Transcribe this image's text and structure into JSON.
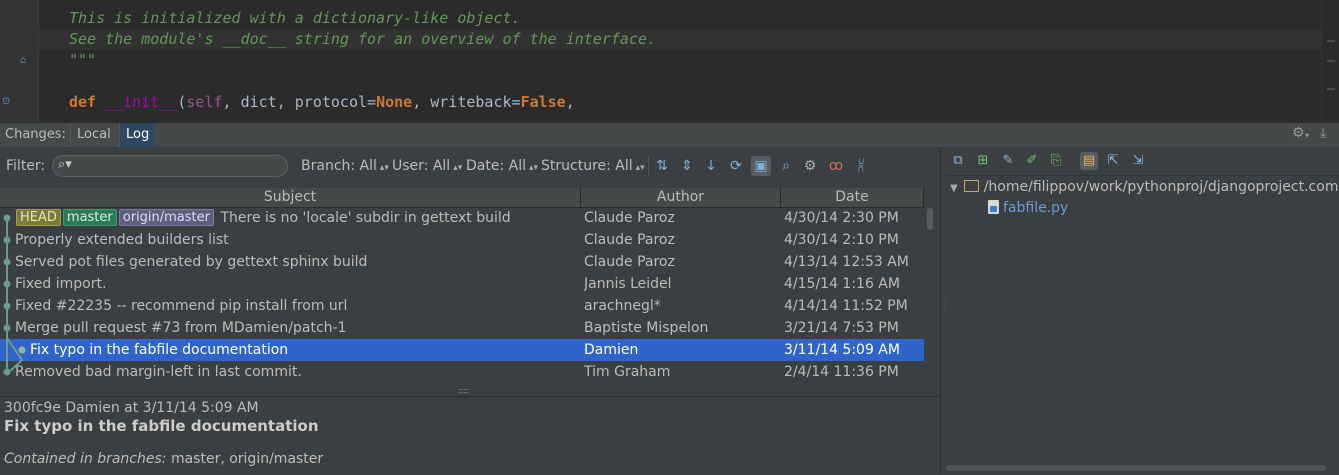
{
  "editor": {
    "lines": [
      "This is initialized with a dictionary-like object.",
      "See the module's __doc__ string for an overview of the interface.",
      "\"\"\""
    ],
    "def_line": {
      "kw_def": "def",
      "fn_name": "__init__",
      "open": "(",
      "self": "self",
      "args_a": ", dict, protocol=",
      "none": "None",
      "args_b": ", writeback=",
      "false": "False",
      "close": ","
    }
  },
  "toolwindow": {
    "title": "Changes:",
    "tabs": [
      {
        "label": "Local",
        "active": false
      },
      {
        "label": "Log",
        "active": true
      }
    ]
  },
  "filter": {
    "label": "Filter:",
    "value": "",
    "dropdowns": [
      {
        "label": "Branch: All"
      },
      {
        "label": "User: All"
      },
      {
        "label": "Date: All"
      },
      {
        "label": "Structure: All"
      }
    ]
  },
  "log": {
    "columns": [
      "Subject",
      "Author",
      "Date"
    ],
    "badges": [
      "HEAD",
      "master",
      "origin/master"
    ],
    "rows": [
      {
        "subject": "There is no 'locale' subdir in gettext build",
        "author": "Claude Paroz",
        "date": "4/30/14 2:30 PM"
      },
      {
        "subject": "Properly extended builders list",
        "author": "Claude Paroz",
        "date": "4/30/14 2:10 PM"
      },
      {
        "subject": "Served pot files generated by gettext sphinx build",
        "author": "Claude Paroz",
        "date": "4/13/14 12:53 AM"
      },
      {
        "subject": "Fixed import.",
        "author": "Jannis Leidel",
        "date": "4/15/14 1:16 AM"
      },
      {
        "subject": "Fixed #22235 -- recommend pip install from url",
        "author": "arachnegl*",
        "date": "4/14/14 11:52 PM"
      },
      {
        "subject": "Merge pull request #73 from MDamien/patch-1",
        "author": "Baptiste Mispelon",
        "date": "3/21/14 7:53 PM"
      },
      {
        "subject": "Fix typo in the fabfile documentation",
        "author": "Damien",
        "date": "3/11/14 5:09 AM"
      },
      {
        "subject": "Removed bad margin-left in last commit.",
        "author": "Tim Graham",
        "date": "2/4/14 11:36 PM"
      }
    ],
    "selected_index": 6
  },
  "details": {
    "meta": "300fc9e Damien at 3/11/14 5:09 AM",
    "subject": "Fix typo in the fabfile documentation",
    "branches_label": "Contained in branches:",
    "branches_value": "master, origin/master"
  },
  "changes": {
    "root_path": "/home/filippov/work/pythonproj/djangoproject.com",
    "file": "fabfile.py"
  },
  "colors": {
    "selection": "#2f65ca",
    "graph_node": "#6b9a8e",
    "doc_comment": "#629755",
    "keyword": "#cc7832"
  }
}
